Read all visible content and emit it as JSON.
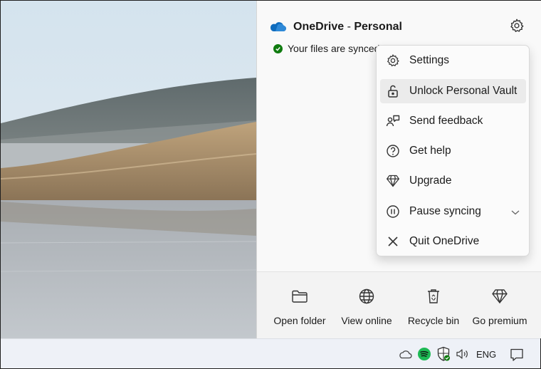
{
  "header": {
    "app_name": "OneDrive",
    "separator": " - ",
    "account": "Personal",
    "status_text": "Your files are synced"
  },
  "menu": {
    "items": [
      {
        "label": "Settings",
        "icon": "gear-icon"
      },
      {
        "label": "Unlock Personal Vault",
        "icon": "unlock-icon"
      },
      {
        "label": "Send feedback",
        "icon": "feedback-icon"
      },
      {
        "label": "Get help",
        "icon": "help-icon"
      },
      {
        "label": "Upgrade",
        "icon": "diamond-icon"
      },
      {
        "label": "Pause syncing",
        "icon": "pause-icon"
      },
      {
        "label": "Quit OneDrive",
        "icon": "close-icon"
      }
    ]
  },
  "actions": [
    {
      "label": "Open folder",
      "icon": "folder-icon"
    },
    {
      "label": "View online",
      "icon": "globe-icon"
    },
    {
      "label": "Recycle bin",
      "icon": "recycle-bin-icon"
    },
    {
      "label": "Go premium",
      "icon": "diamond-icon"
    }
  ],
  "taskbar": {
    "language": "ENG"
  },
  "colors": {
    "onedrive_blue": "#0f6cbd",
    "synced_green": "#0f7b0f",
    "spotify_green": "#1db954",
    "menu_highlight": "#ebebeb"
  }
}
